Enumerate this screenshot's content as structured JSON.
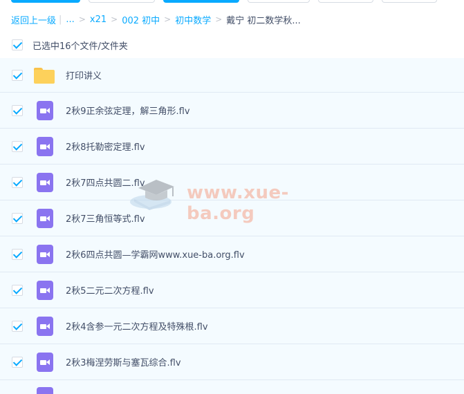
{
  "breadcrumb": {
    "back": "返回上一级",
    "ellipsis": "...",
    "items": [
      "x21",
      "002 初中",
      "初中数学"
    ],
    "current": "戴宁 初二数学秋..."
  },
  "selection": {
    "text": "已选中16个文件/文件夹"
  },
  "files": [
    {
      "name": "打印讲义",
      "type": "folder-icon"
    },
    {
      "name": "2秋9正余弦定理，解三角形.flv",
      "type": "video-icon"
    },
    {
      "name": "2秋8托勒密定理.flv",
      "type": "video-icon"
    },
    {
      "name": "2秋7四点共圆二.flv",
      "type": "video-icon"
    },
    {
      "name": "2秋7三角恒等式.flv",
      "type": "video-icon"
    },
    {
      "name": "2秋6四点共圆—学霸网www.xue-ba.org.flv",
      "type": "video-icon"
    },
    {
      "name": "2秋5二元二次方程.flv",
      "type": "video-icon"
    },
    {
      "name": "2秋4含参一元二次方程及特殊根.flv",
      "type": "video-icon"
    },
    {
      "name": "2秋3梅涅劳斯与塞瓦综合.flv",
      "type": "video-icon"
    }
  ],
  "watermark": {
    "text": "www.xue-ba.org"
  },
  "colors": {
    "accent": "#09aaff",
    "row_bg": "#f4fbff",
    "video_icon": "#8a74f0",
    "folder_icon": "#fdd15b"
  }
}
